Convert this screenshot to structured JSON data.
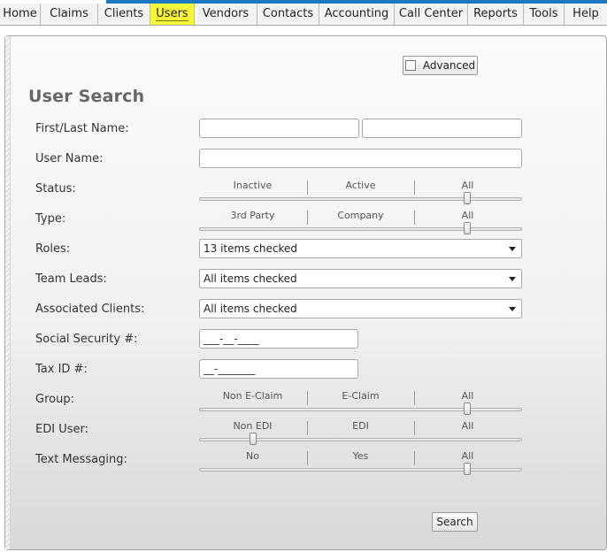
{
  "nav": {
    "items": [
      "Home",
      "Claims",
      "Clients",
      "Users",
      "Vendors",
      "Contacts",
      "Accounting",
      "Call Center",
      "Reports",
      "Tools",
      "Help"
    ],
    "active": "Users"
  },
  "advanced": {
    "label": "Advanced",
    "checked": false
  },
  "title": "User Search",
  "labels": {
    "name": "First/Last Name:",
    "username": "User Name:",
    "status": "Status:",
    "type": "Type:",
    "roles": "Roles:",
    "team_leads": "Team Leads:",
    "associated_clients": "Associated Clients:",
    "ssn": "Social Security #:",
    "tax_id": "Tax ID #:",
    "group": "Group:",
    "edi_user": "EDI User:",
    "text_messaging": "Text Messaging:"
  },
  "inputs": {
    "first_name": "",
    "last_name": "",
    "username": "",
    "ssn_mask": "___-__-____",
    "tax_id_mask": "__-_______"
  },
  "sliders": {
    "status": {
      "options": [
        "Inactive",
        "Active",
        "All"
      ],
      "selected": "All"
    },
    "type": {
      "options": [
        "3rd Party",
        "Company",
        "All"
      ],
      "selected": "All"
    },
    "group": {
      "options": [
        "Non E-Claim",
        "E-Claim",
        "All"
      ],
      "selected": "All"
    },
    "edi_user": {
      "options": [
        "Non EDI",
        "EDI",
        "All"
      ],
      "selected": "Non EDI"
    },
    "text_messaging": {
      "options": [
        "No",
        "Yes",
        "All"
      ],
      "selected": "All"
    }
  },
  "combos": {
    "roles": "13 items checked",
    "team_leads": "All items checked",
    "associated_clients": "All items checked"
  },
  "search_button": "Search"
}
